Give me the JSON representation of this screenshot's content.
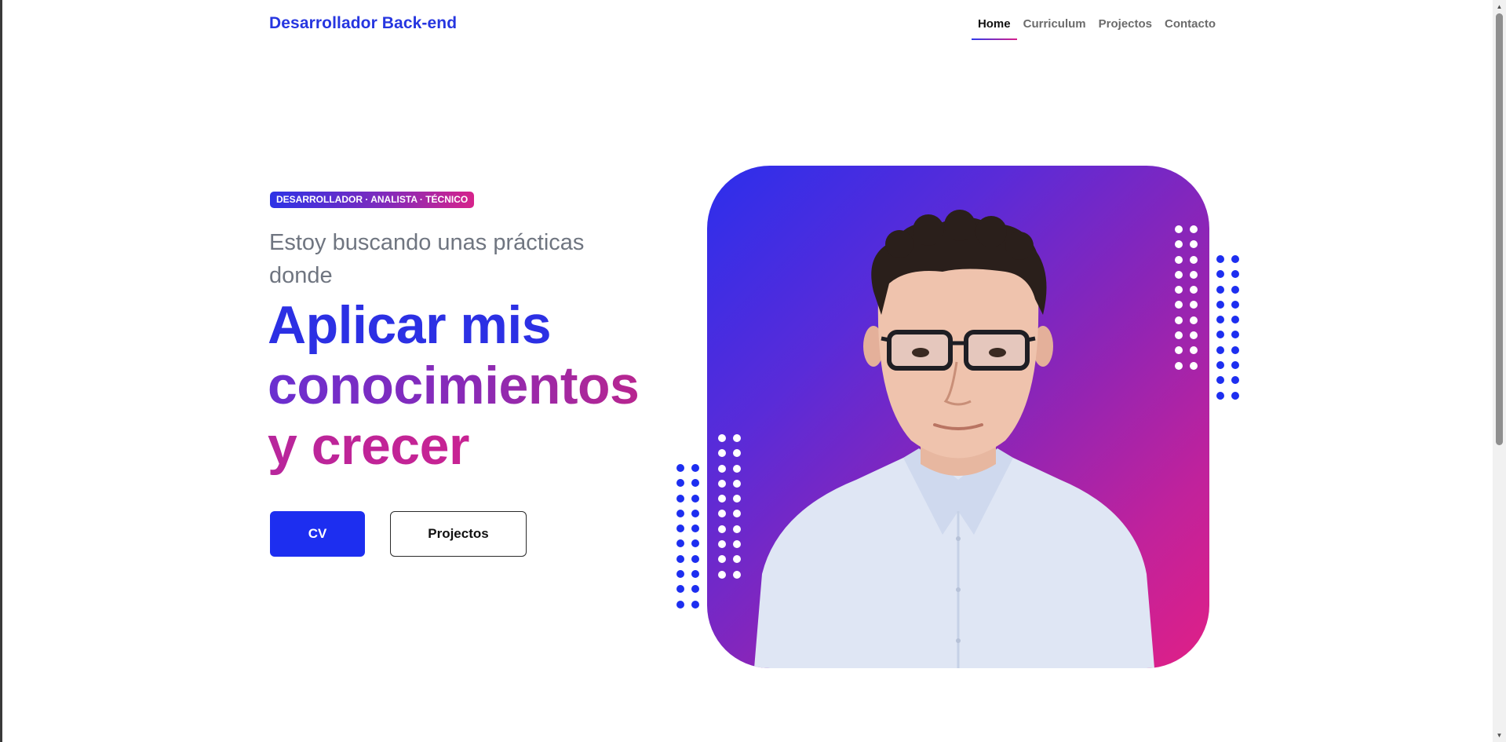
{
  "header": {
    "brand": "Desarrollador Back-end",
    "nav": [
      {
        "label": "Home",
        "active": true
      },
      {
        "label": "Curriculum",
        "active": false
      },
      {
        "label": "Projectos",
        "active": false
      },
      {
        "label": "Contacto",
        "active": false
      }
    ]
  },
  "hero": {
    "badge": "DESARROLLADOR · ANALISTA · TÉCNICO",
    "subtitle": "Estoy buscando unas prácticas donde",
    "headline": {
      "line1": "Aplicar mis",
      "line2": "conocimientos",
      "line3": "y crecer"
    },
    "cv_button": "CV",
    "projects_button": "Projectos"
  },
  "colors": {
    "brand_blue": "#2636e0",
    "button_blue": "#1d2ef0",
    "gradient_start": "#2c2fec",
    "gradient_end": "#e01f86",
    "dots_blue": "#1d2ef0",
    "dots_white": "#ffffff"
  },
  "icons": {
    "scroll_up": "triangle-up-icon",
    "scroll_down": "triangle-down-icon"
  }
}
